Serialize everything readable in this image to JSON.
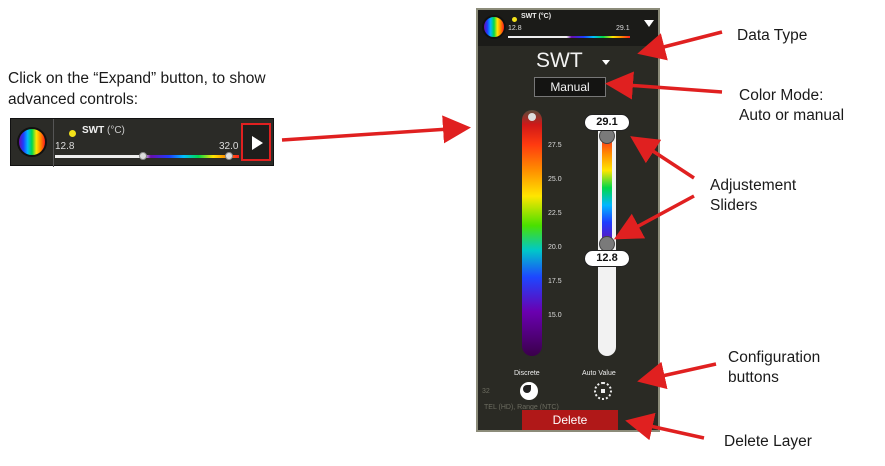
{
  "instruction": {
    "line1": "Click on the “Expand” button, to show",
    "line2": "advanced controls:"
  },
  "mini_widget": {
    "layer_name": "SWT",
    "unit": "(°C)",
    "range_min": "12.8",
    "range_max": "32.0",
    "icons": [
      "colormap-globe-icon",
      "layer-dot-icon",
      "expand-icon"
    ]
  },
  "panel": {
    "layer_name": "SWT",
    "unit": "(°C)",
    "range_min": "12.8",
    "range_max": "29.1",
    "data_type": "SWT",
    "color_mode": "Manual",
    "scale_ticks": [
      "27.5",
      "25.0",
      "22.5",
      "20.0",
      "17.5",
      "15.0"
    ],
    "slider_max": "29.1",
    "slider_min": "12.8",
    "discrete_label": "Discrete",
    "auto_value_label": "Auto Value",
    "faint_text": [
      "32",
      "TEL (HD), Range (NTC)"
    ],
    "delete_label": "Delete",
    "icons": [
      "collapse-icon",
      "data-type-caret-icon",
      "discrete-icon",
      "auto-value-icon"
    ]
  },
  "callouts": {
    "data_type": "Data Type",
    "color_mode_1": "Color Mode:",
    "color_mode_2": "Auto or manual",
    "sliders_1": "Adjustement",
    "sliders_2": "Sliders",
    "config_1": "Configuration",
    "config_2": "buttons",
    "delete_layer": "Delete Layer"
  },
  "colors": {
    "arrow_red": "#e02020",
    "panel_bg": "#2a2a24",
    "delete_red": "#b01818",
    "expand_highlight": "#e02020"
  }
}
